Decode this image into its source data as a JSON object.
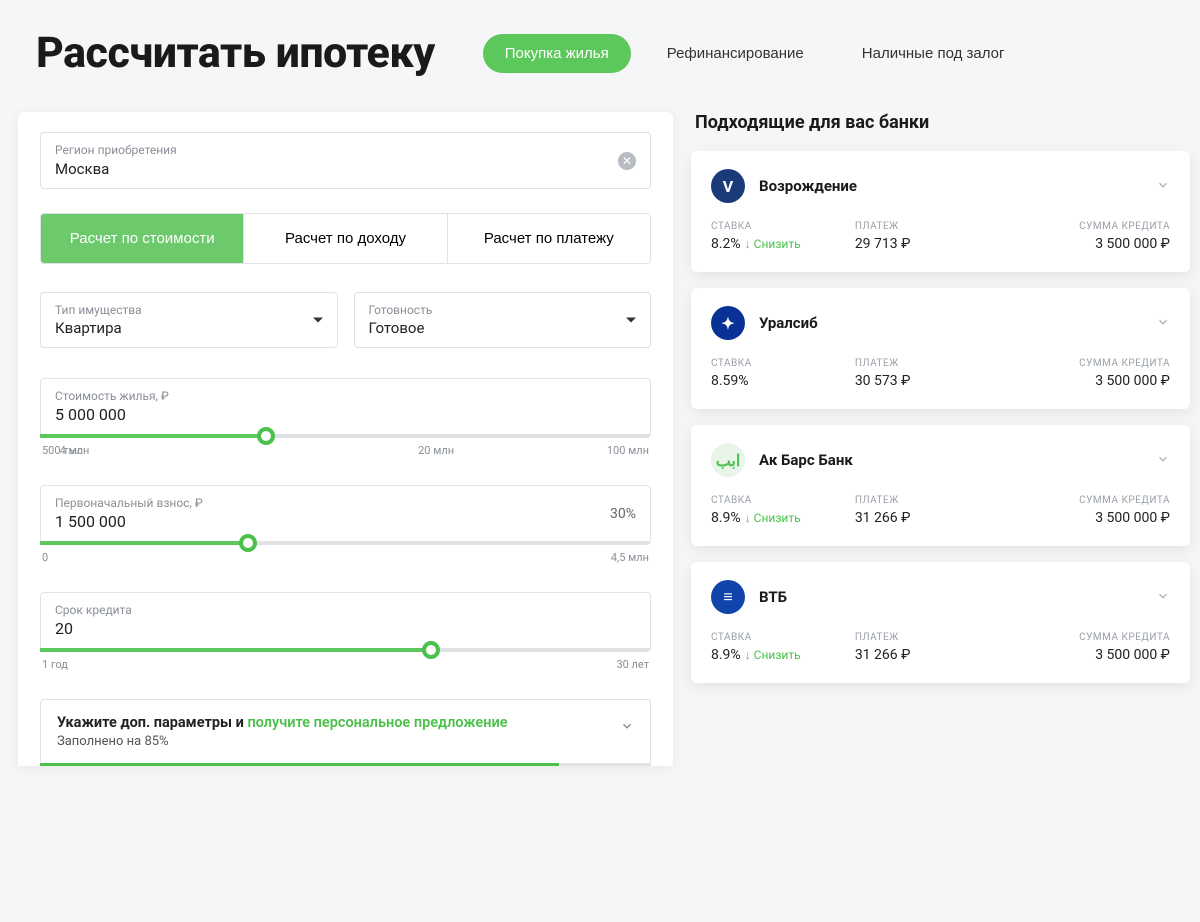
{
  "header": {
    "title": "Рассчитать ипотеку",
    "pills": [
      "Покупка жилья",
      "Рефинансирование",
      "Наличные под залог"
    ],
    "active_pill": 0
  },
  "form": {
    "region": {
      "label": "Регион приобретения",
      "value": "Москва"
    },
    "calc_tabs": [
      "Расчет по стоимости",
      "Расчет по доходу",
      "Расчет по платежу"
    ],
    "active_tab": 0,
    "property_type": {
      "label": "Тип имущества",
      "value": "Квартира"
    },
    "readiness": {
      "label": "Готовность",
      "value": "Готовое"
    },
    "sliders": {
      "price": {
        "label": "Стоимость жилья, ₽",
        "value": "5 000 000",
        "min": "500 тыс",
        "mid1": "4 млн",
        "mid2": "20 млн",
        "max": "100 млн",
        "pct": 37
      },
      "down": {
        "label": "Первоначальный взнос, ₽",
        "value": "1 500 000",
        "extra": "30%",
        "min": "0",
        "max": "4,5 млн",
        "pct": 34
      },
      "term": {
        "label": "Срок кредита",
        "value": "20",
        "min": "1 год",
        "max": "30 лет",
        "pct": 64
      }
    },
    "expand": {
      "title_a": "Укажите доп. параметры и ",
      "title_b": "получите персональное предложение",
      "sub": "Заполнено на 85%",
      "pct": 85
    }
  },
  "banks": {
    "title": "Подходящие для вас банки",
    "labels": {
      "rate": "СТАВКА",
      "payment": "ПЛАТЕЖ",
      "amount": "СУММА КРЕДИТА",
      "lower": "Снизить"
    },
    "list": [
      {
        "name": "Возрождение",
        "logo_bg": "#1a3a7a",
        "logo_text": "V",
        "rate": "8.2%",
        "lower": true,
        "payment": "29 713 ₽",
        "amount": "3 500 000 ₽"
      },
      {
        "name": "Уралсиб",
        "logo_bg": "#0a3296",
        "logo_text": "✦",
        "rate": "8.59%",
        "lower": false,
        "payment": "30 573 ₽",
        "amount": "3 500 000 ₽"
      },
      {
        "name": "Ак Барс Банк",
        "logo_bg": "#e8f5e8",
        "logo_text": "ابب",
        "logo_color": "#4bc04b",
        "rate": "8.9%",
        "lower": true,
        "payment": "31 266 ₽",
        "amount": "3 500 000 ₽"
      },
      {
        "name": "ВТБ",
        "logo_bg": "#1144aa",
        "logo_text": "≡",
        "rate": "8.9%",
        "lower": true,
        "payment": "31 266 ₽",
        "amount": "3 500 000 ₽"
      }
    ]
  }
}
